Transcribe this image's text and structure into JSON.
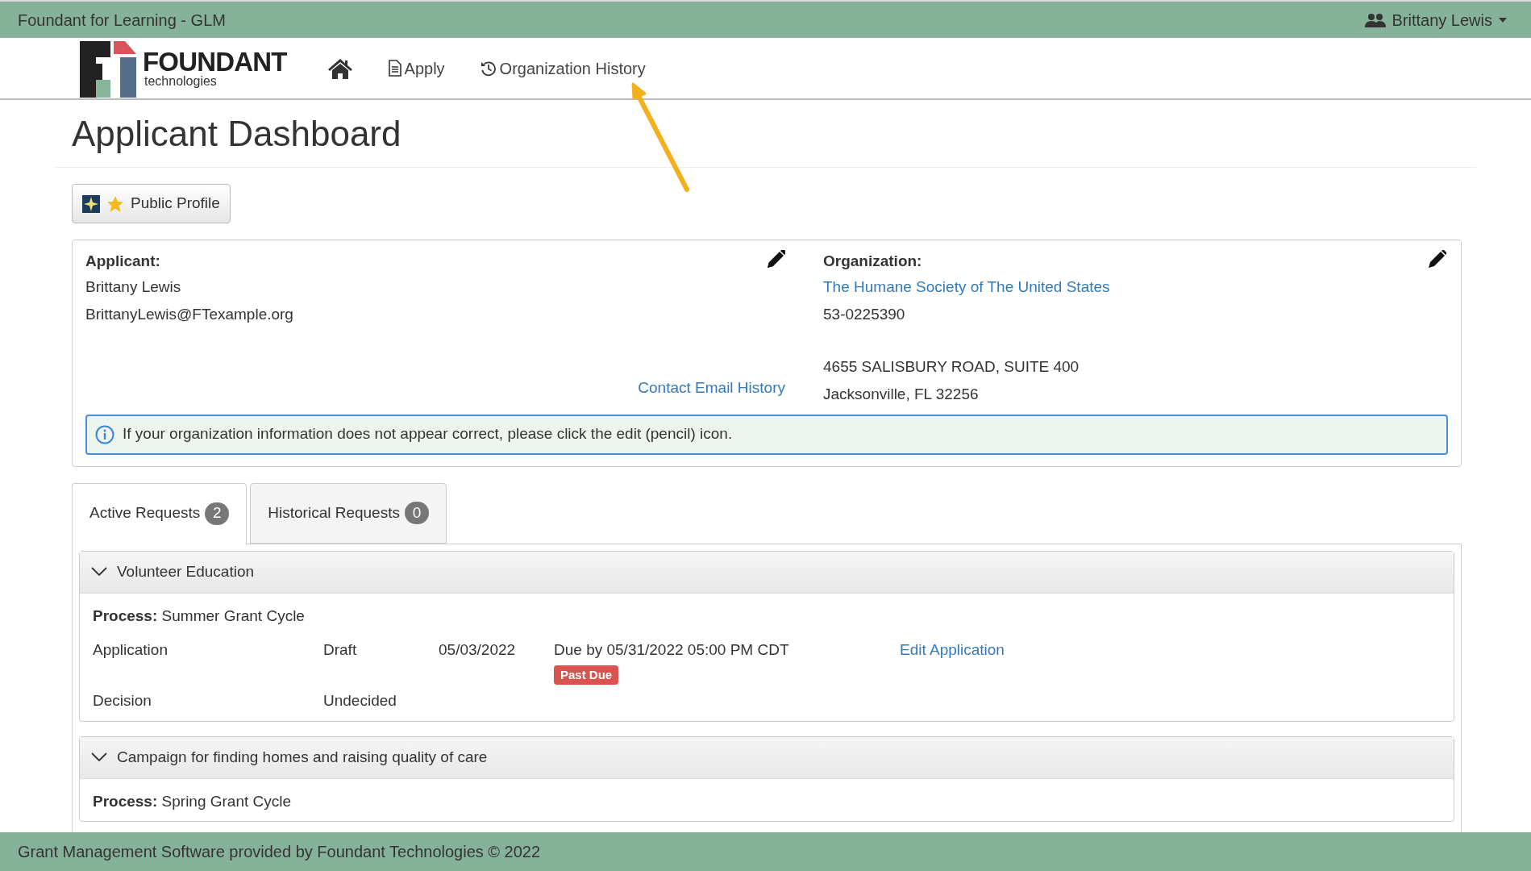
{
  "top_bar": {
    "title": "Foundant for Learning - GLM",
    "user": "Brittany Lewis"
  },
  "nav": {
    "logo_word": "FOUNDANT",
    "logo_sub": "technologies",
    "links": [
      {
        "kind": "home"
      },
      {
        "kind": "apply",
        "label": "Apply"
      },
      {
        "kind": "history",
        "label": "Organization History"
      }
    ]
  },
  "page_title": "Applicant Dashboard",
  "public_profile_button": "Public Profile",
  "applicant": {
    "heading": "Applicant:",
    "name": "Brittany Lewis",
    "email": "BrittanyLewis@FTexample.org",
    "link": "Contact Email History"
  },
  "organization": {
    "heading": "Organization:",
    "name": "The Humane Society of The United States",
    "ein": "53-0225390",
    "address_1": "4655 SALISBURY ROAD, SUITE 400",
    "address_2": "Jacksonville, FL 32256"
  },
  "info_alert": "If your organization information does not appear correct, please click the edit (pencil) icon.",
  "tabs": [
    {
      "label": "Active Requests",
      "count": "2",
      "selected": true
    },
    {
      "label": "Historical Requests",
      "count": "0",
      "selected": false
    }
  ],
  "requests": [
    {
      "title": "Volunteer Education",
      "expanded": true,
      "process_label": "Process:",
      "process": "Summer Grant Cycle",
      "rows": [
        {
          "kind": "application",
          "name": "Application",
          "status": "Draft",
          "date": "05/03/2022",
          "due": "Due by 05/31/2022 05:00 PM CDT",
          "badge": "Past Due",
          "action": "Edit Application"
        },
        {
          "kind": "decision",
          "name": "Decision",
          "status": "Undecided"
        }
      ]
    },
    {
      "title": "Campaign for finding homes and raising quality of care",
      "expanded": true,
      "process_label": "Process:",
      "process": "Spring Grant Cycle"
    }
  ],
  "footer": "Grant Management Software provided by Foundant Technologies © 2022"
}
